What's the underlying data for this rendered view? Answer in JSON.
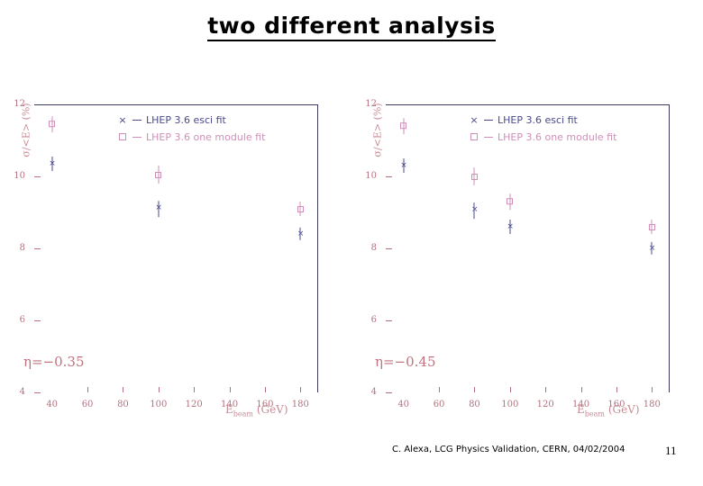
{
  "slide": {
    "title": "two different analysis",
    "footer": "C. Alexa, LCG Physics Validation, CERN, 04/02/2004",
    "page_number": "11"
  },
  "colors": {
    "cross_series": "#4a4a8c",
    "square_series": "#cf8fb8",
    "axis": "#b4727f",
    "frame": "#3a3a5e",
    "annotation": "#c1737d"
  },
  "legend": {
    "cross_key": "×",
    "square_key": "□",
    "dash": "—",
    "cross_label": "LHEP 3.6 esci fit",
    "square_label": "LHEP 3.6 one module fit"
  },
  "axis": {
    "ylabel": "σ/<E> (%)",
    "xlabel_main": "E",
    "xlabel_sub": "beam",
    "xlabel_unit": "(GeV)",
    "yticks": [
      "12",
      "10",
      "8",
      "6",
      "4"
    ],
    "xticks": [
      "40",
      "60",
      "80",
      "100",
      "120",
      "140",
      "160",
      "180"
    ]
  },
  "chart_data": [
    {
      "type": "scatter",
      "title": "two different analysis",
      "annotation": "η=−0.35",
      "xlabel": "E_beam (GeV)",
      "ylabel": "σ/<E> (%)",
      "xlim": [
        30,
        190
      ],
      "ylim": [
        4,
        12
      ],
      "grid": false,
      "legend_position": "top-right",
      "series": [
        {
          "name": "LHEP 3.6 esci fit",
          "marker": "cross",
          "color": "#4a4a8c",
          "x": [
            40,
            100,
            180
          ],
          "y": [
            10.35,
            9.1,
            8.4
          ],
          "yerr": [
            0.2,
            0.22,
            0.18
          ]
        },
        {
          "name": "LHEP 3.6 one module fit",
          "marker": "square",
          "color": "#cf8fb8",
          "x": [
            40,
            100,
            180
          ],
          "y": [
            11.45,
            10.05,
            9.1
          ],
          "yerr": [
            0.22,
            0.25,
            0.2
          ]
        }
      ]
    },
    {
      "type": "scatter",
      "title": "two different analysis",
      "annotation": "η=−0.45",
      "xlabel": "E_beam (GeV)",
      "ylabel": "σ/<E> (%)",
      "xlim": [
        30,
        190
      ],
      "ylim": [
        4,
        12
      ],
      "grid": false,
      "legend_position": "top-right",
      "series": [
        {
          "name": "LHEP 3.6 esci fit",
          "marker": "cross",
          "color": "#4a4a8c",
          "x": [
            40,
            80,
            100,
            180
          ],
          "y": [
            10.3,
            9.05,
            8.6,
            8.0
          ],
          "yerr": [
            0.2,
            0.22,
            0.2,
            0.18
          ]
        },
        {
          "name": "LHEP 3.6 one module fit",
          "marker": "square",
          "color": "#cf8fb8",
          "x": [
            40,
            80,
            100,
            180
          ],
          "y": [
            11.4,
            10.0,
            9.3,
            8.6
          ],
          "yerr": [
            0.22,
            0.25,
            0.22,
            0.2
          ]
        }
      ]
    }
  ]
}
